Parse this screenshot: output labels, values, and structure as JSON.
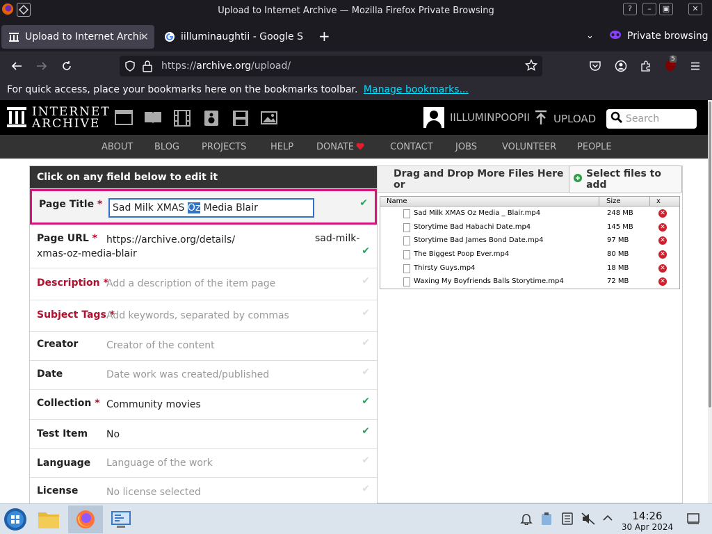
{
  "browser": {
    "window_title": "Upload to Internet Archive — Mozilla Firefox Private Browsing",
    "tabs": [
      {
        "label": "Upload to Internet Archiv",
        "active": true
      },
      {
        "label": "iilluminaughtii - Google S",
        "active": false
      }
    ],
    "new_tab": "+",
    "private_label": "Private browsing",
    "url_prefix": "https://",
    "url_domain": "archive.org",
    "url_path": "/upload/",
    "extension_badge": "5",
    "bookmarks_text": "For quick access, place your bookmarks here on the bookmarks toolbar.",
    "bookmarks_link": "Manage bookmarks..."
  },
  "site": {
    "logo_line1": "INTERNET",
    "logo_line2": "ARCHIVE",
    "username": "IILLUMINPOOPII",
    "upload_label": "UPLOAD",
    "search_placeholder": "Search",
    "nav": [
      "ABOUT",
      "BLOG",
      "PROJECTS",
      "HELP",
      "DONATE",
      "CONTACT",
      "JOBS",
      "VOLUNTEER",
      "PEOPLE"
    ]
  },
  "form": {
    "header": "Click on any field below to edit it",
    "title_label": "Page Title",
    "title_value_pre": "Sad Milk XMAS ",
    "title_value_sel": "Oz",
    "title_value_post": " Media Blair",
    "url_label": "Page URL",
    "url_value": "https://archive.org/details/",
    "url_slug_a": "sad-milk-",
    "url_slug_b": "xmas-oz-media-blair",
    "description_label": "Description",
    "description_placeholder": "Add a description of the item page",
    "tags_label": "Subject Tags",
    "tags_placeholder": "Add keywords, separated by commas",
    "creator_label": "Creator",
    "creator_placeholder": "Creator of the content",
    "date_label": "Date",
    "date_placeholder": "Date work was created/published",
    "collection_label": "Collection",
    "collection_value": "Community movies",
    "test_label": "Test Item",
    "test_value": "No",
    "language_label": "Language",
    "language_placeholder": "Language of the work",
    "license_label": "License",
    "license_placeholder": "No license selected",
    "required_mark": "*"
  },
  "files": {
    "drop_text": "Drag and Drop More Files Here or",
    "select_button": "Select files to add",
    "col_name": "Name",
    "col_size": "Size",
    "col_x": "x",
    "rows": [
      {
        "name": "Sad Milk XMAS Oz Media _ Blair.mp4",
        "size": "248 MB"
      },
      {
        "name": "Storytime Bad Habachi Date.mp4",
        "size": "145 MB"
      },
      {
        "name": "Storytime Bad James Bond Date.mp4",
        "size": "97 MB"
      },
      {
        "name": "The Biggest Poop Ever.mp4",
        "size": "80 MB"
      },
      {
        "name": "Thirsty Guys.mp4",
        "size": "18 MB"
      },
      {
        "name": "Waxing My Boyfriends Balls Storytime.mp4",
        "size": "72 MB"
      }
    ]
  },
  "taskbar": {
    "time": "14:26",
    "date": "30 Apr 2024"
  },
  "colors": {
    "accent_pink": "#d3177a",
    "required_red": "#b2102f",
    "check_green": "#29a35a",
    "link_cyan": "#00ddff"
  }
}
